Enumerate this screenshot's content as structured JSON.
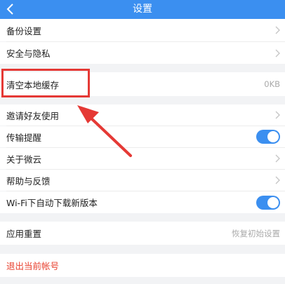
{
  "header": {
    "title": "设置",
    "back_icon": "chevron-left-icon"
  },
  "rows": {
    "backup": {
      "label": "备份设置"
    },
    "security": {
      "label": "安全与隐私"
    },
    "clear_cache": {
      "label": "清空本地缓存",
      "value": "0KB"
    },
    "invite": {
      "label": "邀请好友使用"
    },
    "transfer_reminder": {
      "label": "传输提醒",
      "enabled": true
    },
    "about": {
      "label": "关于微云"
    },
    "help": {
      "label": "帮助与反馈"
    },
    "wifi_update": {
      "label": "Wi-Fi下自动下载新版本",
      "enabled": true
    },
    "reset": {
      "label": "应用重置",
      "value": "恢复初始设置"
    },
    "logout": {
      "label": "退出当前帐号"
    }
  },
  "colors": {
    "accent": "#3b8ff0",
    "danger": "#e8412f",
    "annotation": "#e53935"
  }
}
